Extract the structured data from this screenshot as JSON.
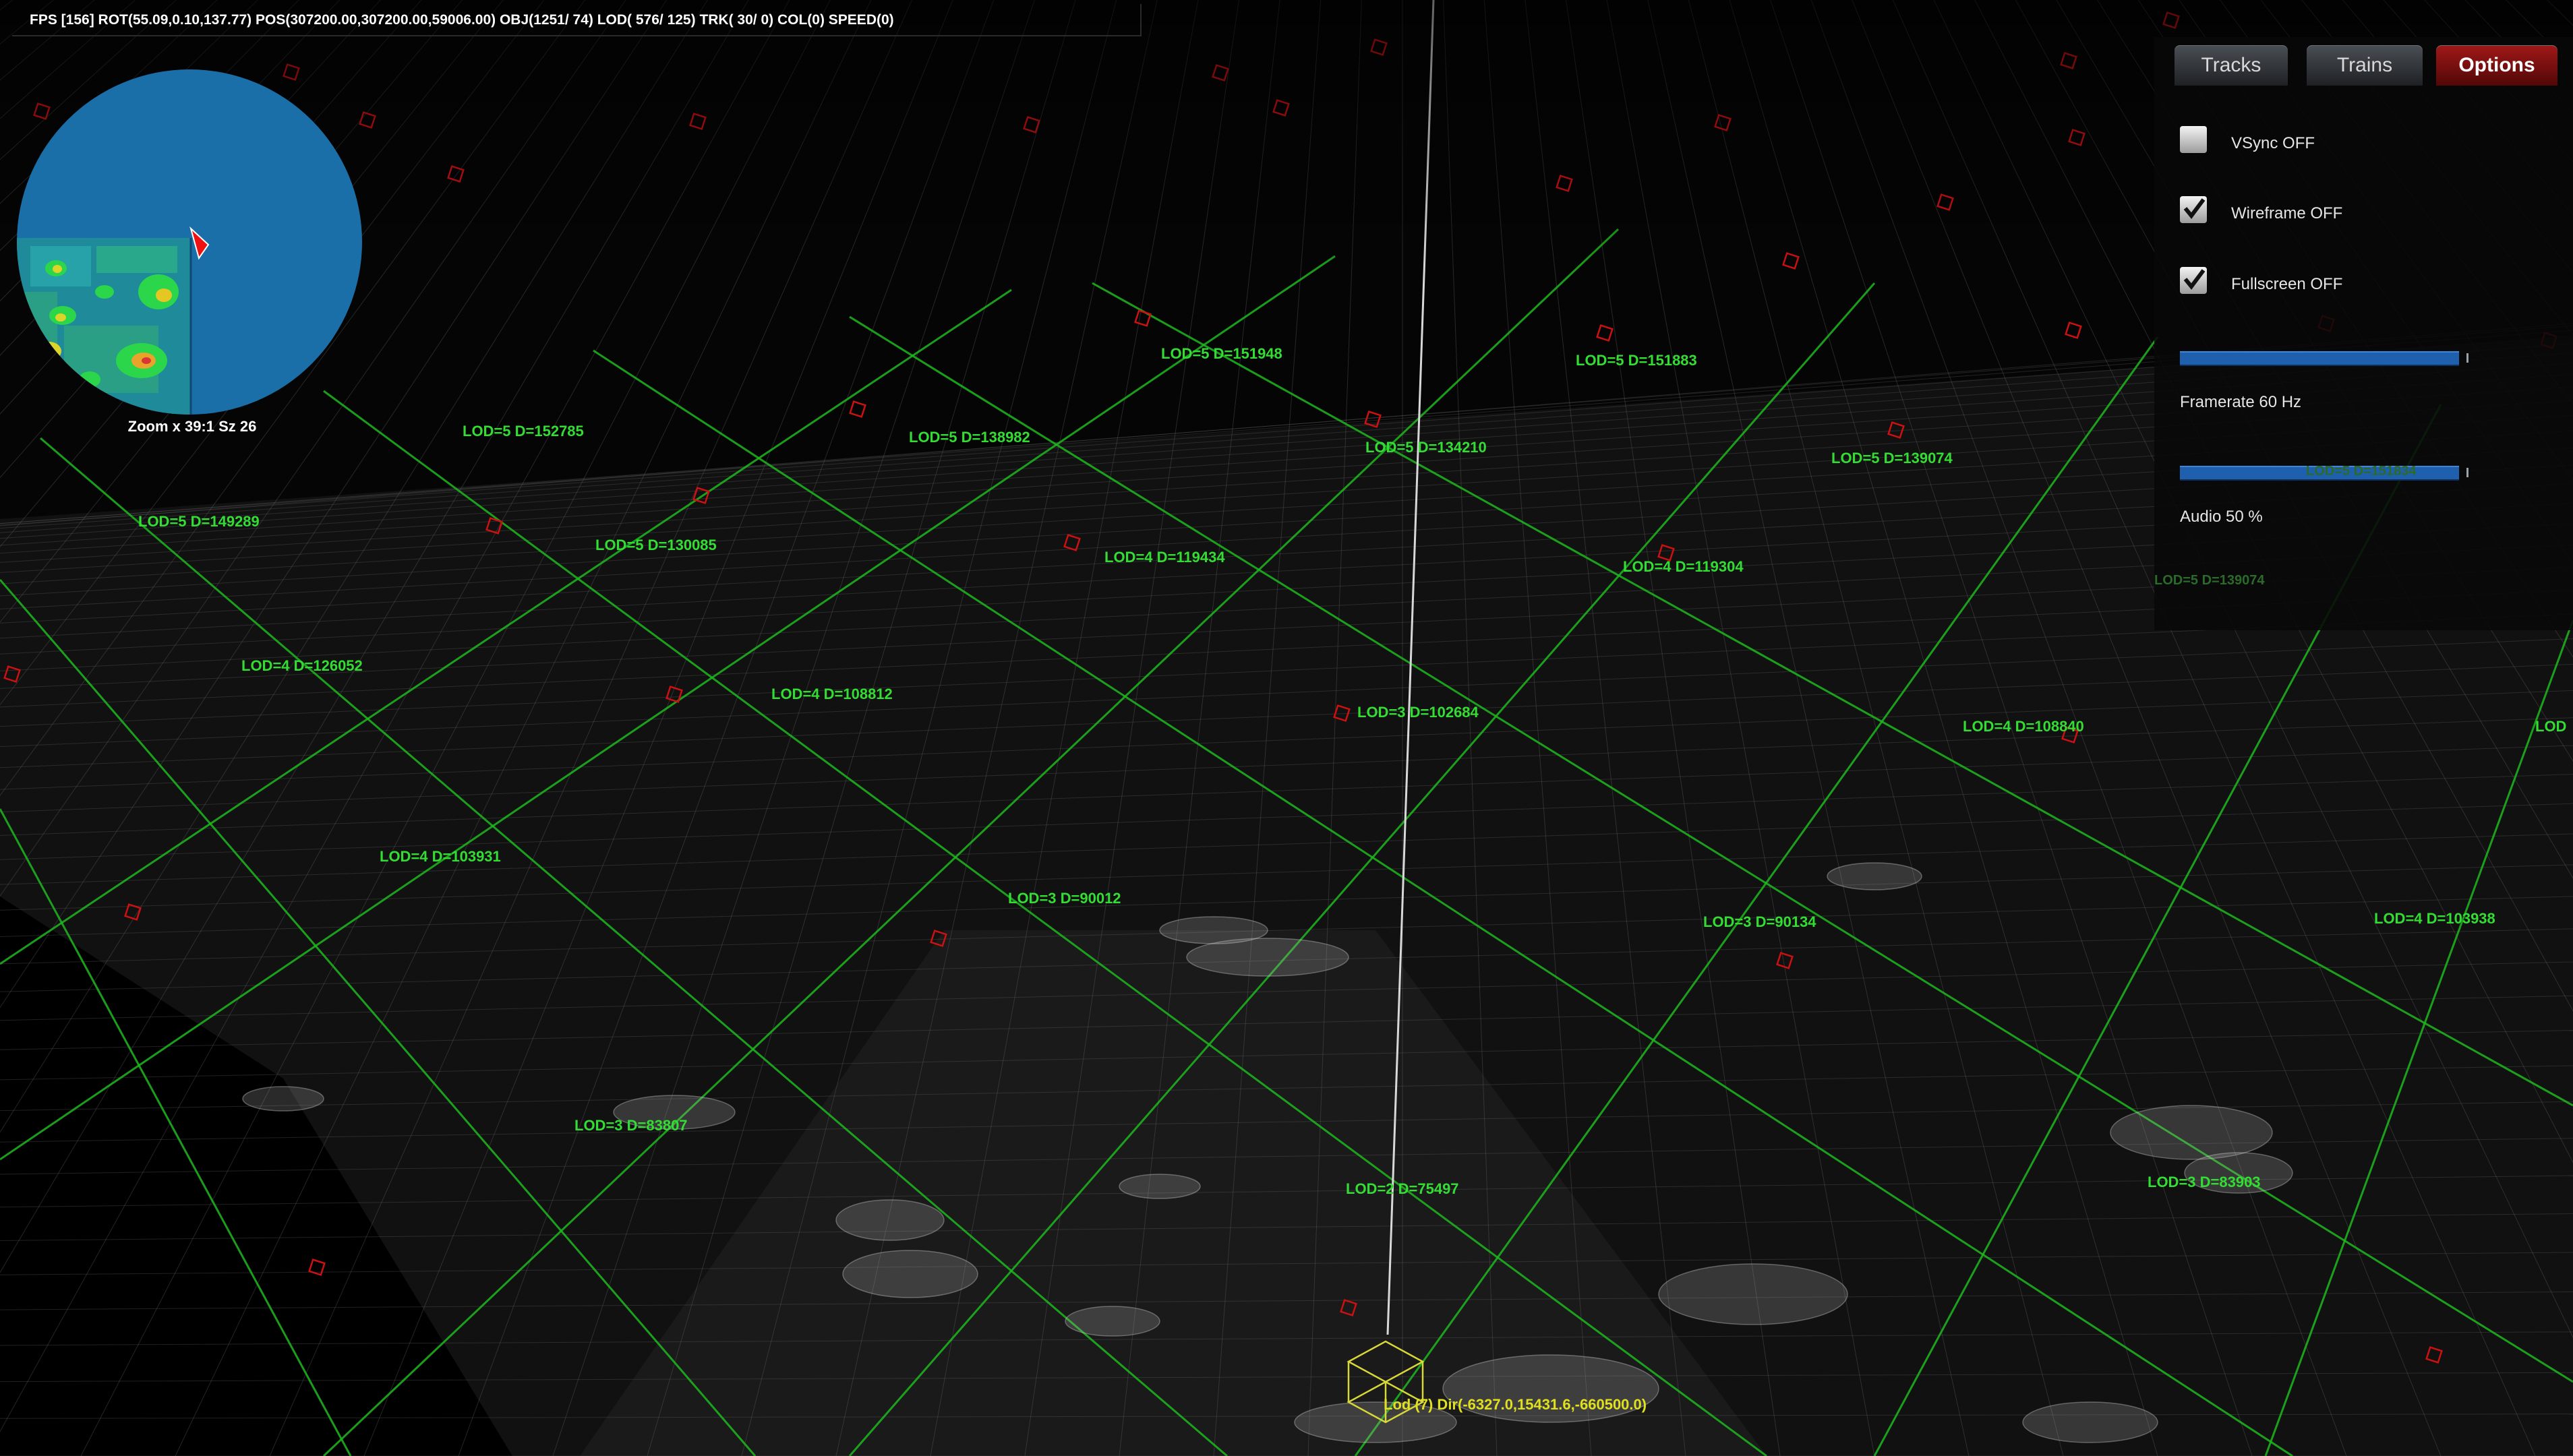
{
  "hud": {
    "stats": "FPS [156] ROT(55.09,0.10,137.77) POS(307200.00,307200.00,59006.00) OBJ(1251/ 74) LOD( 576/ 125) TRK(  30/   0) COL(0)  SPEED(0)"
  },
  "minimap": {
    "zoom_label": "Zoom x 39:1 Sz 26"
  },
  "panel": {
    "tabs": [
      {
        "label": "Tracks",
        "active": false
      },
      {
        "label": "Trains",
        "active": false
      },
      {
        "label": "Options",
        "active": true
      }
    ],
    "options": [
      {
        "label": "VSync OFF",
        "checked": false
      },
      {
        "label": "Wireframe OFF",
        "checked": true
      },
      {
        "label": "Fullscreen OFF",
        "checked": true
      }
    ],
    "framerate": {
      "label": "Framerate 60 Hz",
      "fill_fraction": 1.0
    },
    "audio": {
      "label": "Audio 50 %",
      "fill_fraction": 1.0
    },
    "ghost_labels": [
      "LOD=5 D=151834",
      "LOD=5 D=139074"
    ]
  },
  "scene": {
    "lod_labels": [
      "LOD=5 D=151948",
      "LOD=5 D=151883",
      "LOD=5 D=152785",
      "LOD=5 D=138982",
      "LOD=5 D=134210",
      "LOD=5 D=139074",
      "LOD=5 D=149289",
      "LOD=5 D=130085",
      "LOD=4 D=119434",
      "LOD=4 D=119304",
      "LOD=4 D=126052",
      "LOD=4 D=108812",
      "LOD=3 D=102684",
      "LOD=4 D=108840",
      "LOD",
      "LOD=4 D=103931",
      "LOD=3 D=90012",
      "LOD=3 D=90134",
      "LOD=4 D=103938",
      "LOD=3 D=83807",
      "LOD=2 D=75497",
      "LOD=3 D=83903"
    ],
    "cursor_label": "Lod  (7) Dir(-6327.0,15431.6,-660500.0)"
  },
  "colors": {
    "grid_green": "#1fb81f",
    "label_green": "#33dd33",
    "marker_red": "#cc1111",
    "wire_white": "#cfcfcf",
    "cursor_yellow": "#e0e020",
    "minimap_water": "#1a6fa8",
    "tab_active": "#8e1414",
    "slider_blue": "#1e5fae"
  }
}
